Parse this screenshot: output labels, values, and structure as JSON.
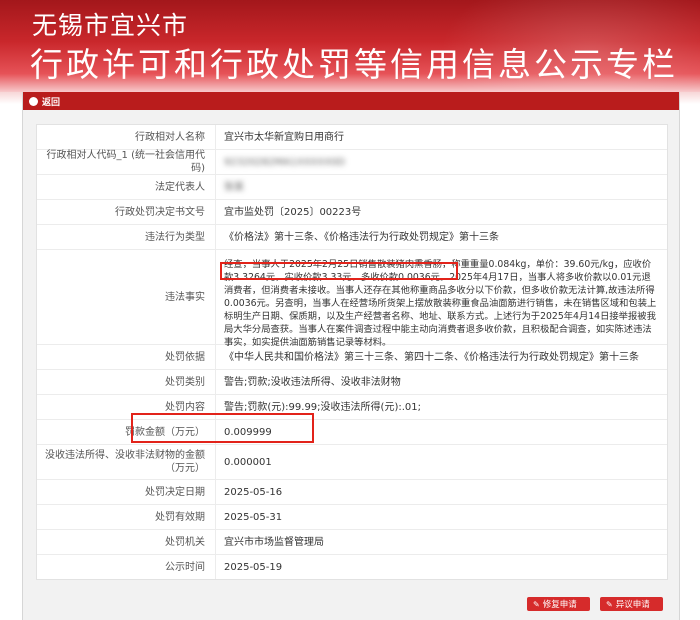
{
  "header": {
    "city": "无锡市宜兴市",
    "title": "行政许可和行政处罚等信用信息公示专栏"
  },
  "panel": {
    "back_label": "返回"
  },
  "rows": [
    {
      "label": "行政相对人名称",
      "value": "宜兴市太华新宜购日用商行"
    },
    {
      "label": "行政相对人代码_1 (统一社会信用代码)",
      "value": "92320282MA1XXXXX0D"
    },
    {
      "label": "法定代表人",
      "value": "张某"
    },
    {
      "label": "行政处罚决定书文号",
      "value": "宜市监处罚〔2025〕00223号"
    },
    {
      "label": "违法行为类型",
      "value": "《价格法》第十三条、《价格违法行为行政处罚规定》第十三条"
    },
    {
      "label": "违法事实",
      "value": "经查，当事人于2025年2月25日销售散装猪肉熏香肠，称重重量0.084kg，单价：39.60元/kg，应收价款3.3264元，实收价款3.33元，多收价款0.0036元。2025年4月17日，当事人将多收价款以0.01元退消费者，但消费者未接收。当事人还存在其他称重商品多收分以下价款，但多收价款无法计算,故违法所得0.0036元。另查明，当事人在经营场所货架上摆放散装称重食品油面筋进行销售，未在销售区域和包装上标明生产日期、保质期，以及生产经营者名称、地址、联系方式。上述行为于2025年4月14日接举报被我局大华分局查获。当事人在案件调查过程中能主动向消费者退多收价款，且积极配合调查，如实陈述违法事实，如实提供油面筋销售记录等材料。"
    },
    {
      "label": "处罚依据",
      "value": "《中华人民共和国价格法》第三十三条、第四十二条、《价格违法行为行政处罚规定》第十三条"
    },
    {
      "label": "处罚类别",
      "value": "警告;罚款;没收违法所得、没收非法财物"
    },
    {
      "label": "处罚内容",
      "value": "警告;罚款(元):99.99;没收违法所得(元):.01;"
    },
    {
      "label": "罚款金额（万元）",
      "value": "0.009999"
    },
    {
      "label": "没收违法所得、没收非法财物的金额（万元）",
      "value": "0.000001"
    },
    {
      "label": "处罚决定日期",
      "value": "2025-05-16"
    },
    {
      "label": "处罚有效期",
      "value": "2025-05-31"
    },
    {
      "label": "处罚机关",
      "value": "宜兴市市场监督管理局"
    },
    {
      "label": "公示时间",
      "value": "2025-05-19"
    }
  ],
  "buttons": {
    "repair_request": "修复申请",
    "objection_request": "异议申请"
  },
  "icons": {
    "repair": "pencil-icon",
    "objection": "pencil-icon"
  },
  "colors": {
    "banner": "#c9272b",
    "panel_header": "#b91c1c",
    "highlight": "#e2231a",
    "button": "#d62b2b"
  }
}
